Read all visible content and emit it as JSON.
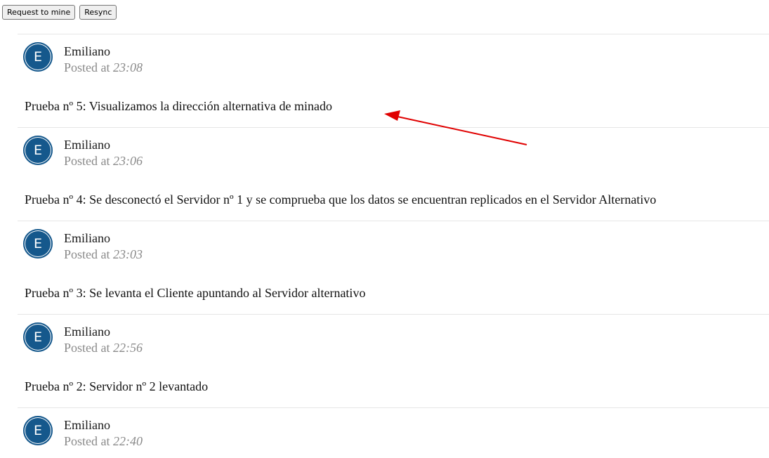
{
  "toolbar": {
    "request_label": "Request to mine",
    "resync_label": "Resync"
  },
  "posted_prefix": "Posted at",
  "posts": [
    {
      "avatar_letter": "E",
      "author": "Emiliano",
      "time": "23:08",
      "message": "Prueba nº 5: Visualizamos la dirección alternativa de minado"
    },
    {
      "avatar_letter": "E",
      "author": "Emiliano",
      "time": "23:06",
      "message": "Prueba nº 4: Se desconectó el Servidor nº 1 y se comprueba que los datos se encuentran replicados en el Servidor Alternativo"
    },
    {
      "avatar_letter": "E",
      "author": "Emiliano",
      "time": "23:03",
      "message": "Prueba nº 3: Se levanta el Cliente apuntando al Servidor alternativo"
    },
    {
      "avatar_letter": "E",
      "author": "Emiliano",
      "time": "22:56",
      "message": "Prueba nº 2: Servidor nº 2 levantado"
    },
    {
      "avatar_letter": "E",
      "author": "Emiliano",
      "time": "22:40",
      "message": ""
    }
  ],
  "colors": {
    "avatar": "#15588c",
    "annotation_arrow": "#e00000",
    "muted_text": "#8a8a8a"
  }
}
